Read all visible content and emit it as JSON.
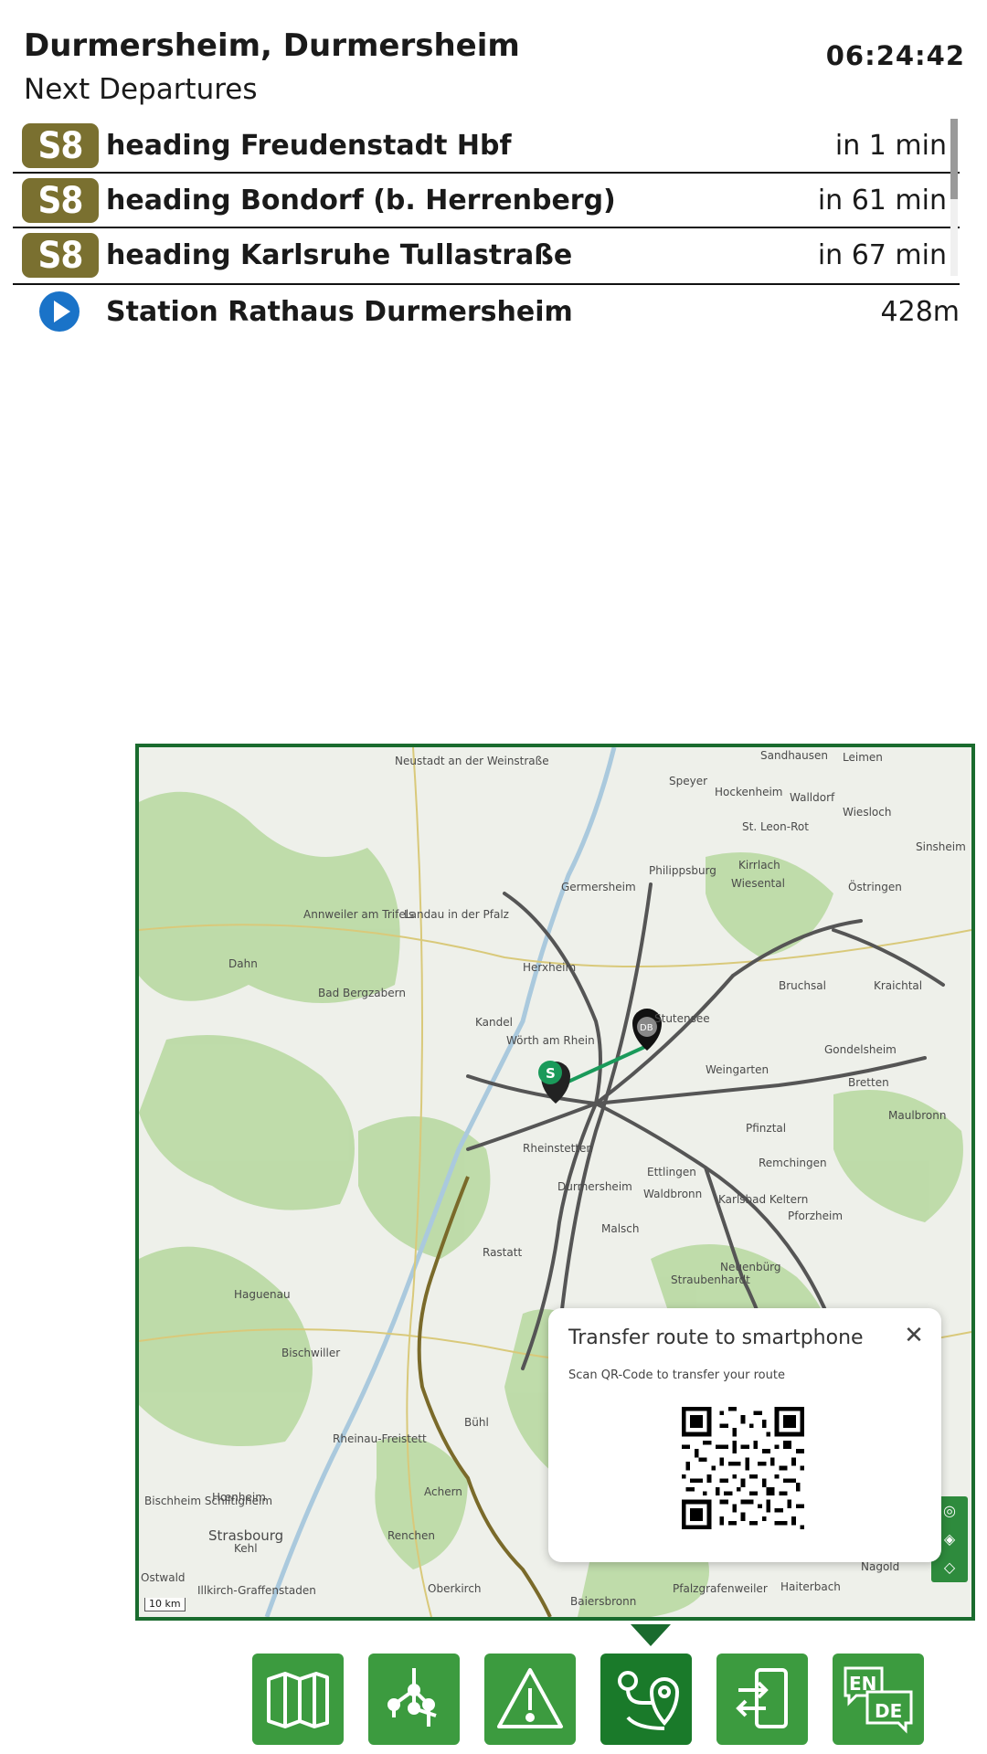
{
  "header": {
    "station": "Durmersheim, Durmersheim",
    "subtitle": "Next Departures",
    "clock": "06:24:42"
  },
  "departures": [
    {
      "line": "S8",
      "heading": "heading Freudenstadt Hbf",
      "eta": "in 1 min"
    },
    {
      "line": "S8",
      "heading": "heading Bondorf (b. Herrenberg)",
      "eta": "in 61 min"
    },
    {
      "line": "S8",
      "heading": "heading Karlsruhe Tullastraße",
      "eta": "in 67 min"
    }
  ],
  "nearby_station": {
    "name": "Station Rathaus Durmersheim",
    "distance": "428m",
    "icon": "play-circle-icon"
  },
  "map": {
    "scale_label": "10 km",
    "places": [
      "Neustadt an der Weinstraße",
      "Sandhausen",
      "Leimen",
      "Speyer",
      "Hockenheim",
      "Walldorf",
      "Wiesloch",
      "St. Leon-Rot",
      "Sinsheim",
      "Philippsburg",
      "Kirrlach",
      "Wiesental",
      "Östringen",
      "Germersheim",
      "Annweiler am Trifels",
      "Landau in der Pfalz",
      "Dahn",
      "Herxheim",
      "Bruchsal",
      "Kraichtal",
      "Bad Bergzabern",
      "Kandel",
      "Stutensee",
      "Gondelsheim",
      "Wörth am Rhein",
      "Weingarten",
      "Bretten",
      "Pfinztal",
      "Maulbronn",
      "Rheinstetten",
      "Ettlingen",
      "Remchingen",
      "Durmersheim",
      "Waldbronn",
      "Karlsbad Keltern",
      "Pforzheim",
      "Malsch",
      "Rastatt",
      "Neuenbürg",
      "Straubenhardt",
      "Haguenau",
      "Bischwiller",
      "Bühl",
      "Rheinau-Freistett",
      "Achern",
      "Bischheim Schiltigheim",
      "Hœnheim",
      "Strasbourg",
      "Kehl",
      "Renchen",
      "Ostwald",
      "Illkirch-Graffenstaden",
      "Oberkirch",
      "Baiersbronn",
      "Pfalzgrafenweiler",
      "Haiterbach",
      "Nagold"
    ],
    "colors": {
      "border": "#1a6b2e",
      "route": "#1a9a5a",
      "rail": "#4a4a4a"
    }
  },
  "popup": {
    "title": "Transfer route to smartphone",
    "subtitle": "Scan QR-Code to transfer your route",
    "close_icon": "close-icon"
  },
  "toolbar": {
    "buttons": [
      {
        "name": "map-button",
        "icon": "map-icon"
      },
      {
        "name": "network-button",
        "icon": "route-network-icon"
      },
      {
        "name": "alerts-button",
        "icon": "warning-icon"
      },
      {
        "name": "route-button",
        "icon": "route-pin-icon",
        "active": true
      },
      {
        "name": "transfer-button",
        "icon": "phone-transfer-icon"
      },
      {
        "name": "language-button",
        "icon": "language-en-de-icon",
        "labels": [
          "EN",
          "DE"
        ]
      }
    ]
  },
  "colors": {
    "line_badge": "#7a7030",
    "button": "#3c9b3f",
    "button_active": "#1a7a2a",
    "accent_blue": "#1a73c8"
  }
}
